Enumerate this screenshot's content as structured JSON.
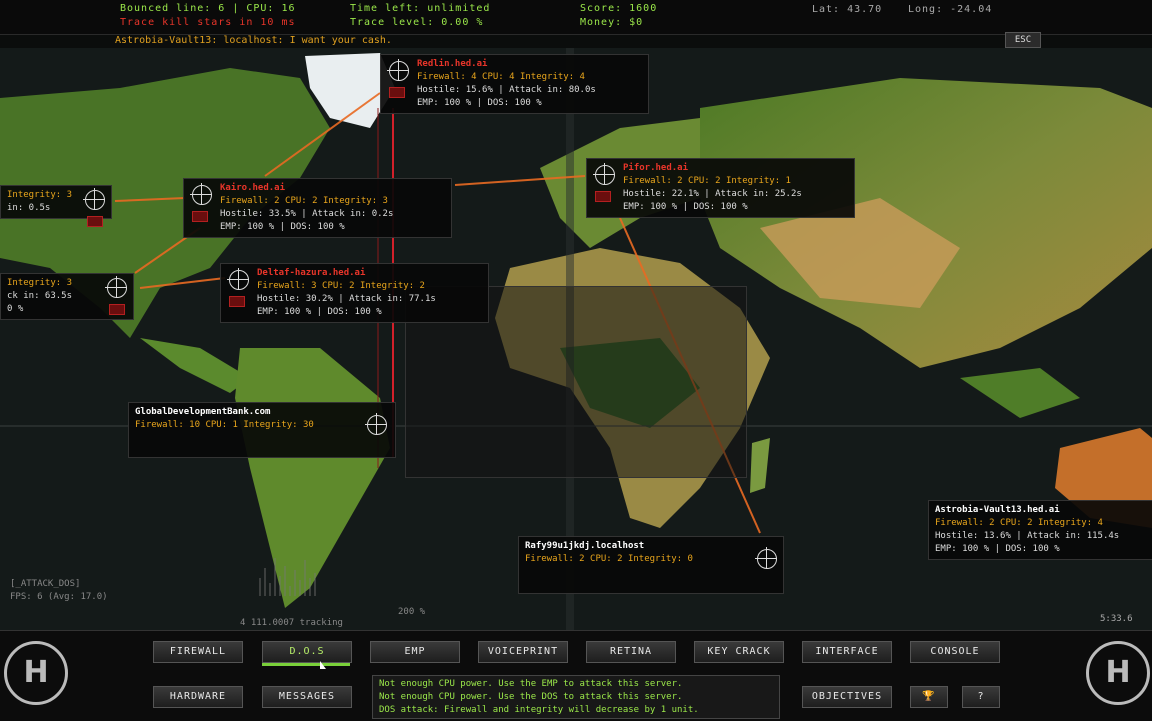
{
  "status": {
    "bounced_line": "Bounced line: 6 | CPU: 16",
    "trace_kill": "Trace kill stars in 10 ms",
    "time_left": "Time left: unlimited",
    "trace_level": "Trace level: 0.00 %",
    "score": "Score: 1600",
    "money": "Money: $0",
    "lat": "Lat: 43.70",
    "long": "Long: -24.04"
  },
  "chat_line": "Astrobia-Vault13: localhost: I want your cash.",
  "esc_label": "ESC",
  "servers": [
    {
      "name": "Redlin.hed.ai",
      "line1": "Firewall: 4 CPU: 4 Integrity: 4",
      "line2": "Hostile: 15.6% | Attack in: 80.0s",
      "line3": "EMP: 100 % | DOS: 100 %"
    },
    {
      "name": "Pifor.hed.ai",
      "line1": "Firewall: 2 CPU: 2 Integrity: 1",
      "line2": "Hostile: 22.1% | Attack in: 25.2s",
      "line3": "EMP: 100 % | DOS: 100 %"
    },
    {
      "name": "Kairo.hed.ai",
      "line1": "Firewall: 2 CPU: 2 Integrity: 3",
      "line2": "Hostile: 33.5% | Attack in: 0.2s",
      "line3": "EMP: 100 % | DOS: 100 %"
    },
    {
      "name": "Deltaf-hazura.hed.ai",
      "line1": "Firewall: 3 CPU: 2 Integrity: 2",
      "line2": "Hostile: 30.2% | Attack in: 77.1s",
      "line3": "EMP: 100 % | DOS: 100 %"
    },
    {
      "name": "",
      "line1": "Integrity: 3",
      "line2": "in: 0.5s",
      "line3": ""
    },
    {
      "name": "",
      "line1": "Integrity: 3",
      "line2": "ck in: 63.5s",
      "line3": "0 %"
    },
    {
      "name": "GlobalDevelopmentBank.com",
      "line1": "Firewall: 10 CPU: 1 Integrity: 30",
      "line2": "",
      "line3": ""
    },
    {
      "name": "Rafy99u1jkdj.localhost",
      "line1": "Firewall: 2 CPU: 2 Integrity: 0",
      "line2": "",
      "line3": ""
    },
    {
      "name": "Astrobia-Vault13.hed.ai",
      "line1": "Firewall: 2 CPU: 2 Integrity: 4",
      "line2": "Hostile: 13.6% | Attack in: 115.4s",
      "line3": "EMP: 100 % | DOS: 100 %"
    }
  ],
  "fps": {
    "label": "[_ATTACK_DOS]",
    "value": "FPS: 6 (Avg: 17.0)",
    "scale": "200 %",
    "tracking": "4 111.0007 tracking"
  },
  "timer": "5:33.6",
  "buttons": {
    "firewall": "FIREWALL",
    "dos": "D.O.S",
    "emp": "EMP",
    "voiceprint": "VOICEPRINT",
    "retina": "RETINA",
    "key_crack": "KEY CRACK",
    "interface": "INTERFACE",
    "console": "CONSOLE",
    "hardware": "HARDWARE",
    "messages": "MESSAGES",
    "objectives": "OBJECTIVES",
    "trophy": "🏆",
    "help": "?"
  },
  "messages": [
    "Not enough CPU power. Use the EMP to attack this server.",
    "Not enough CPU power. Use the DOS to attack this server.",
    "DOS attack: Firewall and integrity will decrease by 1 unit."
  ],
  "logo_text": "H"
}
